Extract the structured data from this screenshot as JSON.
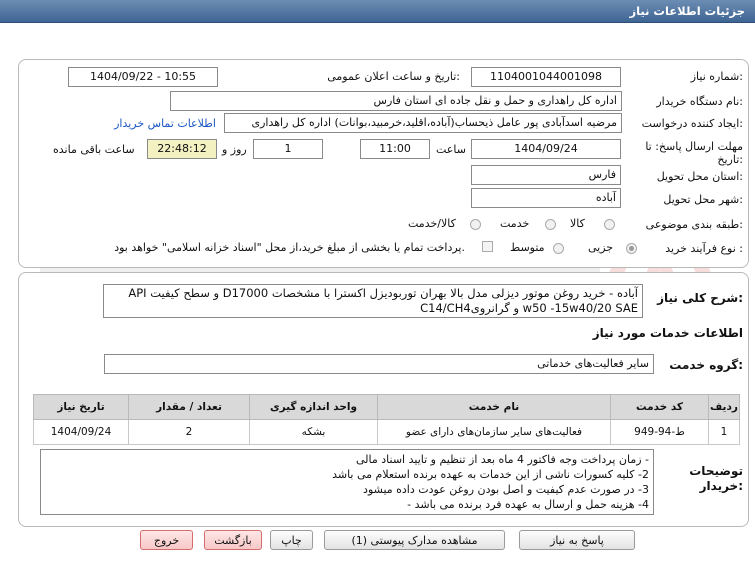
{
  "header": {
    "title": "جزئیات اطلاعات نیاز"
  },
  "need_number": {
    "label": "شماره نیاز:",
    "value": "1104001044001098"
  },
  "announce_datetime": {
    "label": "تاریخ و ساعت اعلان عمومی:",
    "value": "1404/09/22 - 10:55"
  },
  "buyer_org": {
    "label": "نام دستگاه خریدار:",
    "value": "اداره کل راهداری و حمل و نقل جاده ای استان فارس"
  },
  "requester": {
    "label": "ایجاد کننده درخواست:",
    "value": "مرضیه اسدآبادی پور عامل ذیحساب(آباده،اقلید،خرمبید،بوانات) اداره کل راهداری",
    "contact_link": "اطلاعات تماس خریدار"
  },
  "deadline": {
    "label": "مهلت ارسال پاسخ: تا تاریخ:",
    "date": "1404/09/24",
    "time_label": "ساعت",
    "time": "11:00",
    "days": "1",
    "days_label": "روز و",
    "remaining": "22:48:12",
    "remaining_label": "ساعت باقی مانده"
  },
  "delivery_province": {
    "label": "استان محل تحویل:",
    "value": "فارس"
  },
  "delivery_city": {
    "label": "شهر محل تحویل:",
    "value": "آباده"
  },
  "category": {
    "label": "طبقه بندی موضوعی:",
    "options": [
      "کالا",
      "خدمت",
      "کالا/خدمت"
    ]
  },
  "process_type": {
    "label": "نوع فرآیند خرید :",
    "options": [
      "جزیی",
      "متوسط"
    ],
    "payment_note": "پرداخت تمام یا بخشی از مبلغ خرید،از محل \"اسناد خزانه اسلامی\" خواهد بود."
  },
  "description": {
    "label": "شرح کلی نیاز:",
    "line1": "آباده - خرید روغن موتور دیزلی مدل بالا بهران توربودیزل اکسترا با مشخصات D17000 و سطح کیفیت API",
    "line2": "C14/CH4و گرانروی w50 -15w40/20  SAE"
  },
  "services_info": {
    "title": "اطلاعات خدمات مورد نیاز"
  },
  "service_group": {
    "label": "گروه خدمت:",
    "value": "سایر فعالیت‌های خدماتی"
  },
  "table": {
    "headers": [
      "ردیف",
      "کد خدمت",
      "نام خدمت",
      "واحد اندازه گیری",
      "تعداد / مقدار",
      "تاریخ نیاز"
    ],
    "rows": [
      [
        "1",
        "ط-94-949",
        "فعالیت‌های سایر سازمان‌های دارای عضو",
        "بشکه",
        "2",
        "1404/09/24"
      ]
    ]
  },
  "notes": {
    "label": "توضیحات خریدار:",
    "lines": [
      "- زمان پرداخت وجه فاکتور 4 ماه بعد از تنظیم و تایید اسناد مالی",
      "2- کلیه کسورات ناشی از این خدمات به عهده برنده استعلام می باشد",
      "3- در صورت عدم کیفیت و اصل بودن روغن عودت داده میشود",
      "4- هزینه حمل و ارسال به عهده فرد برنده می باشد -"
    ]
  },
  "buttons": {
    "reply": "پاسخ به نیاز",
    "attachments": "مشاهده مدارک پیوستی (1)",
    "print": "چاپ",
    "back": "بازگشت",
    "exit": "خروج"
  },
  "colors": {
    "header": "#4a6f9c",
    "remaining_bg": "#f3f0c2",
    "link": "#1a55c4"
  }
}
